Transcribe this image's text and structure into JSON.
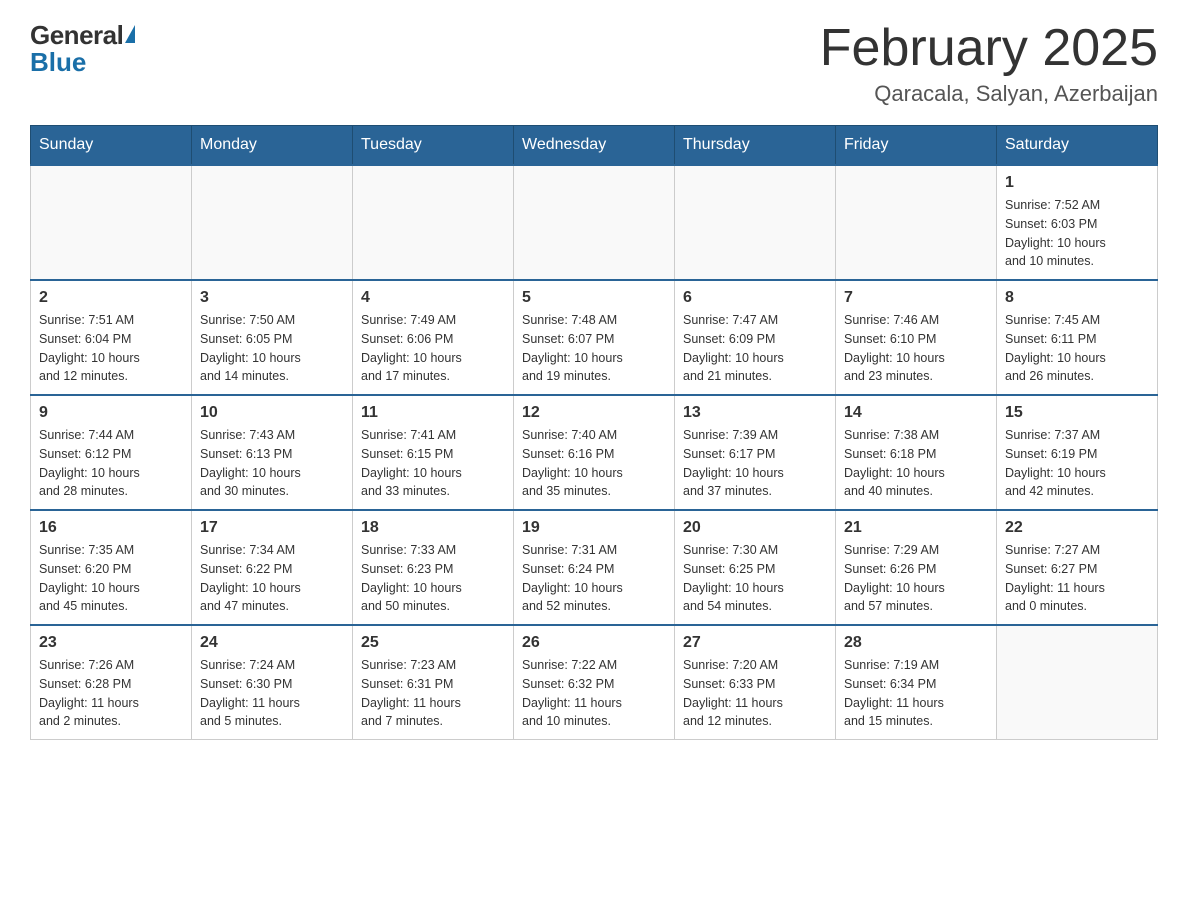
{
  "header": {
    "logo_general": "General",
    "logo_blue": "Blue",
    "title": "February 2025",
    "subtitle": "Qaracala, Salyan, Azerbaijan"
  },
  "weekdays": [
    "Sunday",
    "Monday",
    "Tuesday",
    "Wednesday",
    "Thursday",
    "Friday",
    "Saturday"
  ],
  "weeks": [
    [
      {
        "day": "",
        "info": ""
      },
      {
        "day": "",
        "info": ""
      },
      {
        "day": "",
        "info": ""
      },
      {
        "day": "",
        "info": ""
      },
      {
        "day": "",
        "info": ""
      },
      {
        "day": "",
        "info": ""
      },
      {
        "day": "1",
        "info": "Sunrise: 7:52 AM\nSunset: 6:03 PM\nDaylight: 10 hours\nand 10 minutes."
      }
    ],
    [
      {
        "day": "2",
        "info": "Sunrise: 7:51 AM\nSunset: 6:04 PM\nDaylight: 10 hours\nand 12 minutes."
      },
      {
        "day": "3",
        "info": "Sunrise: 7:50 AM\nSunset: 6:05 PM\nDaylight: 10 hours\nand 14 minutes."
      },
      {
        "day": "4",
        "info": "Sunrise: 7:49 AM\nSunset: 6:06 PM\nDaylight: 10 hours\nand 17 minutes."
      },
      {
        "day": "5",
        "info": "Sunrise: 7:48 AM\nSunset: 6:07 PM\nDaylight: 10 hours\nand 19 minutes."
      },
      {
        "day": "6",
        "info": "Sunrise: 7:47 AM\nSunset: 6:09 PM\nDaylight: 10 hours\nand 21 minutes."
      },
      {
        "day": "7",
        "info": "Sunrise: 7:46 AM\nSunset: 6:10 PM\nDaylight: 10 hours\nand 23 minutes."
      },
      {
        "day": "8",
        "info": "Sunrise: 7:45 AM\nSunset: 6:11 PM\nDaylight: 10 hours\nand 26 minutes."
      }
    ],
    [
      {
        "day": "9",
        "info": "Sunrise: 7:44 AM\nSunset: 6:12 PM\nDaylight: 10 hours\nand 28 minutes."
      },
      {
        "day": "10",
        "info": "Sunrise: 7:43 AM\nSunset: 6:13 PM\nDaylight: 10 hours\nand 30 minutes."
      },
      {
        "day": "11",
        "info": "Sunrise: 7:41 AM\nSunset: 6:15 PM\nDaylight: 10 hours\nand 33 minutes."
      },
      {
        "day": "12",
        "info": "Sunrise: 7:40 AM\nSunset: 6:16 PM\nDaylight: 10 hours\nand 35 minutes."
      },
      {
        "day": "13",
        "info": "Sunrise: 7:39 AM\nSunset: 6:17 PM\nDaylight: 10 hours\nand 37 minutes."
      },
      {
        "day": "14",
        "info": "Sunrise: 7:38 AM\nSunset: 6:18 PM\nDaylight: 10 hours\nand 40 minutes."
      },
      {
        "day": "15",
        "info": "Sunrise: 7:37 AM\nSunset: 6:19 PM\nDaylight: 10 hours\nand 42 minutes."
      }
    ],
    [
      {
        "day": "16",
        "info": "Sunrise: 7:35 AM\nSunset: 6:20 PM\nDaylight: 10 hours\nand 45 minutes."
      },
      {
        "day": "17",
        "info": "Sunrise: 7:34 AM\nSunset: 6:22 PM\nDaylight: 10 hours\nand 47 minutes."
      },
      {
        "day": "18",
        "info": "Sunrise: 7:33 AM\nSunset: 6:23 PM\nDaylight: 10 hours\nand 50 minutes."
      },
      {
        "day": "19",
        "info": "Sunrise: 7:31 AM\nSunset: 6:24 PM\nDaylight: 10 hours\nand 52 minutes."
      },
      {
        "day": "20",
        "info": "Sunrise: 7:30 AM\nSunset: 6:25 PM\nDaylight: 10 hours\nand 54 minutes."
      },
      {
        "day": "21",
        "info": "Sunrise: 7:29 AM\nSunset: 6:26 PM\nDaylight: 10 hours\nand 57 minutes."
      },
      {
        "day": "22",
        "info": "Sunrise: 7:27 AM\nSunset: 6:27 PM\nDaylight: 11 hours\nand 0 minutes."
      }
    ],
    [
      {
        "day": "23",
        "info": "Sunrise: 7:26 AM\nSunset: 6:28 PM\nDaylight: 11 hours\nand 2 minutes."
      },
      {
        "day": "24",
        "info": "Sunrise: 7:24 AM\nSunset: 6:30 PM\nDaylight: 11 hours\nand 5 minutes."
      },
      {
        "day": "25",
        "info": "Sunrise: 7:23 AM\nSunset: 6:31 PM\nDaylight: 11 hours\nand 7 minutes."
      },
      {
        "day": "26",
        "info": "Sunrise: 7:22 AM\nSunset: 6:32 PM\nDaylight: 11 hours\nand 10 minutes."
      },
      {
        "day": "27",
        "info": "Sunrise: 7:20 AM\nSunset: 6:33 PM\nDaylight: 11 hours\nand 12 minutes."
      },
      {
        "day": "28",
        "info": "Sunrise: 7:19 AM\nSunset: 6:34 PM\nDaylight: 11 hours\nand 15 minutes."
      },
      {
        "day": "",
        "info": ""
      }
    ]
  ]
}
